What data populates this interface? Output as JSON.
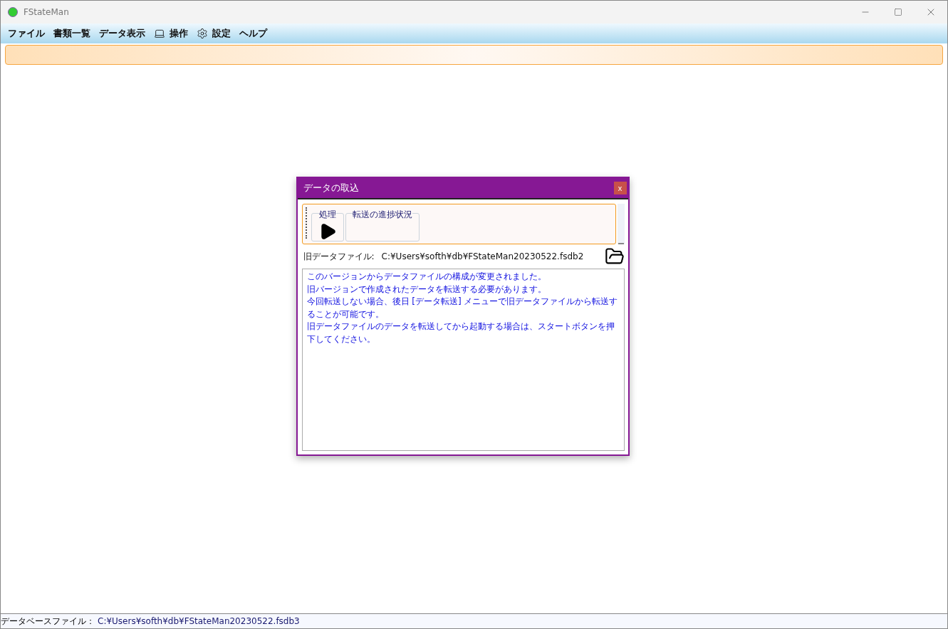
{
  "window": {
    "title": "FStateMan"
  },
  "menu": [
    {
      "label": "ファイル",
      "kind": "plain"
    },
    {
      "label": "書類一覧",
      "kind": "plain"
    },
    {
      "label": "データ表示",
      "kind": "plain"
    },
    {
      "label": "操作",
      "kind": "laptop"
    },
    {
      "label": "設定",
      "kind": "gear"
    },
    {
      "label": "ヘルプ",
      "kind": "plain"
    }
  ],
  "dialog": {
    "title": "データの取込",
    "close": "x",
    "toolbar": [
      {
        "label": "処理",
        "kind": "play"
      },
      {
        "label": "転送の進捗状況",
        "kind": "progress"
      }
    ],
    "old_file_label": "旧データファイル:",
    "old_file_path": "C:¥Users¥softh¥db¥FStateMan20230522.fsdb2",
    "message": [
      "このバージョンからデータファイルの構成が変更されました。",
      "旧バージョンで作成されたデータを転送する必要があります。",
      "今回転送しない場合、後日 [データ転送] メニューで旧データファイルから転送することが可能です。",
      "旧データファイルのデータを転送してから起動する場合は、スタートボタンを押下してください。"
    ]
  },
  "status_bar": {
    "label": "データベースファイル：",
    "path": "C:¥Users¥softh¥db¥FStateMan20230522.fsdb3"
  }
}
